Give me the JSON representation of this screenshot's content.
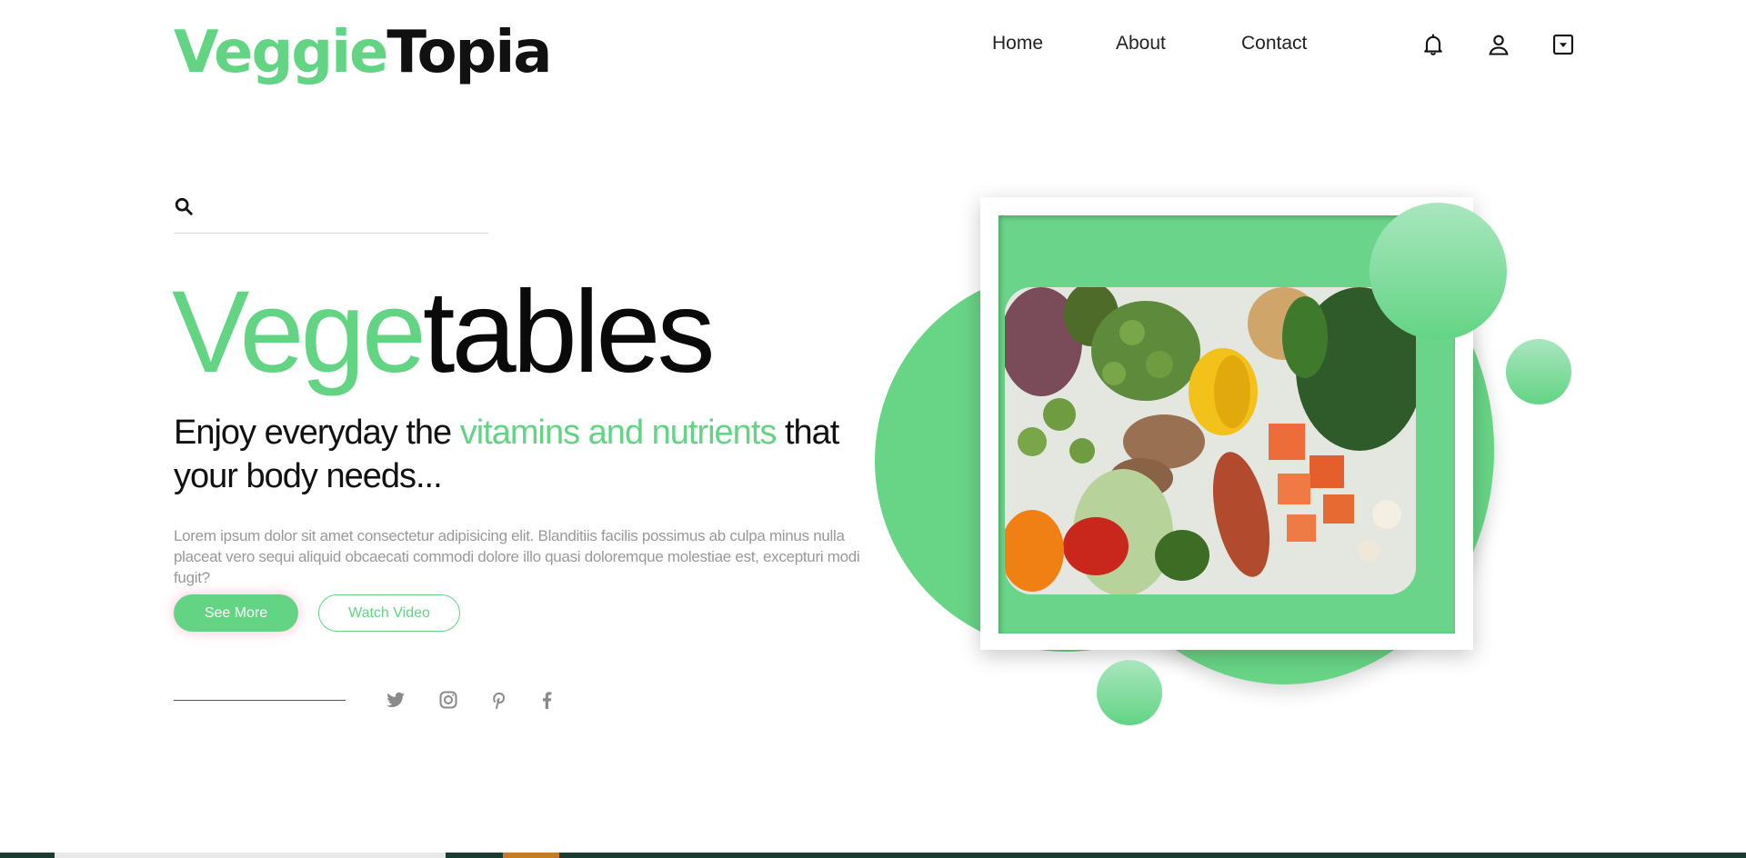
{
  "brand": {
    "part1": "Veggie",
    "part2": "Topia"
  },
  "nav": {
    "home": "Home",
    "about": "About",
    "contact": "Contact"
  },
  "header_icons": [
    "bell-icon",
    "user-icon",
    "dropdown-box-icon"
  ],
  "search": {
    "placeholder": "",
    "value": ""
  },
  "hero": {
    "title_part1": "Vege",
    "title_part2": "tables",
    "subtitle_part1": "Enjoy everyday the ",
    "subtitle_highlight": "vitamins and nutrients",
    "subtitle_part2": " that your body needs...",
    "paragraph": "Lorem ipsum dolor sit amet consectetur adipisicing elit. Blanditiis facilis possimus ab culpa minus nulla placeat vero sequi aliquid obcaecati commodi dolore illo quasi doloremque molestiae est, excepturi modi fugit?",
    "see_more": "See More",
    "watch_video": "Watch Video"
  },
  "social_icons": [
    "twitter-icon",
    "instagram-icon",
    "pinterest-icon",
    "facebook-icon"
  ],
  "colors": {
    "accent": "#63d484",
    "text": "#111111",
    "muted": "#999999"
  }
}
